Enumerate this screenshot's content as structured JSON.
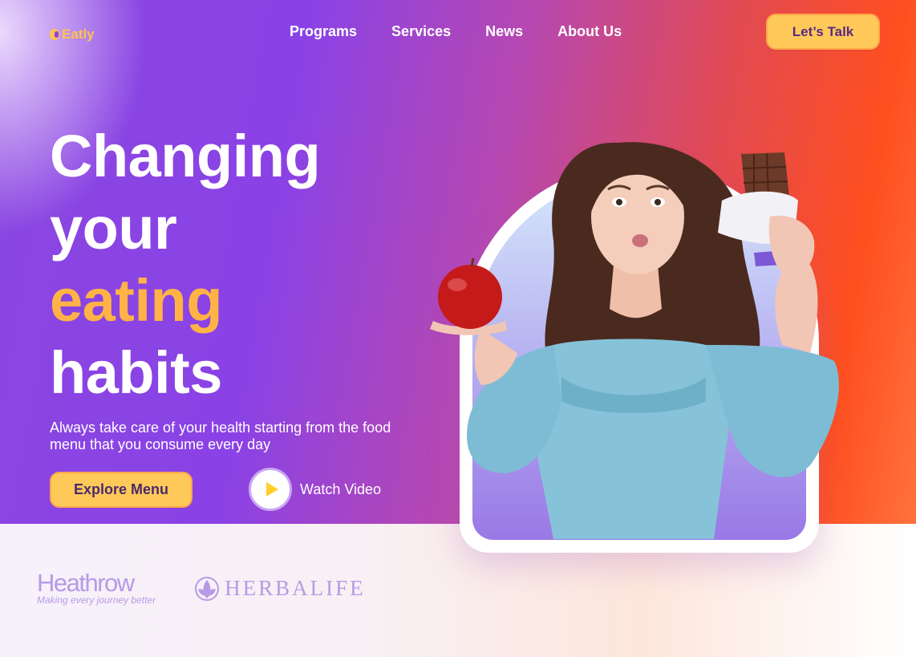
{
  "brand": {
    "name": "Eatly",
    "color": "#ffc24d"
  },
  "nav": {
    "items": [
      {
        "label": "Programs"
      },
      {
        "label": "Services"
      },
      {
        "label": "News"
      },
      {
        "label": "About Us"
      }
    ],
    "cta_label": "Let’s Talk"
  },
  "hero": {
    "headline_line1": "Changing",
    "headline_line2": "your",
    "headline_accent": "eating",
    "headline_line4": "habits",
    "subtitle": "Always take care of your health starting from the food menu that you consume every day",
    "primary_button": "Explore Menu",
    "secondary_button": "Watch Video",
    "accent_color": "#ffb347"
  },
  "partners": {
    "heathrow": {
      "name": "Heathrow",
      "tagline": "Making every journey better"
    },
    "herbalife": {
      "name": "HERBALIFE"
    }
  },
  "icons": {
    "play": "play-icon",
    "logo": "eatly-logo-icon",
    "herbalife": "herbalife-leaf-icon"
  }
}
